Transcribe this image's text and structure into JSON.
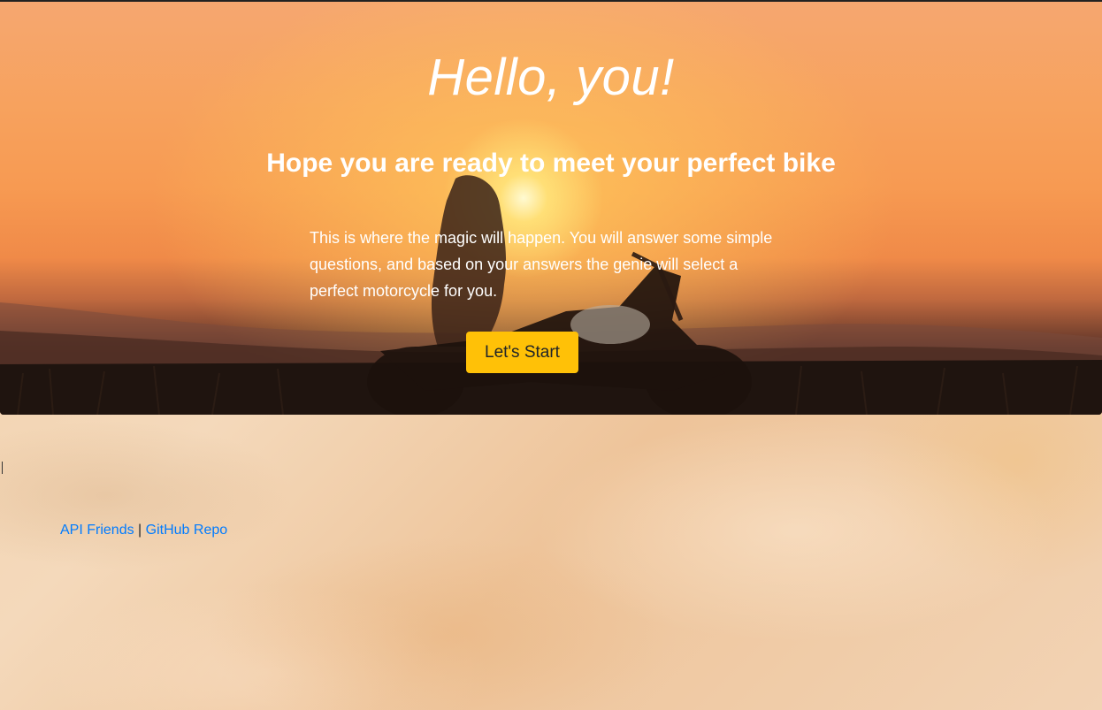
{
  "hero": {
    "title": "Hello, you!",
    "subtitle": "Hope you are ready to meet your perfect bike",
    "text": "This is where the magic will happen. You will answer some simple questions, and based on your answers the genie will select a perfect motorcycle for you.",
    "button_label": "Let's Start",
    "button_color": "#ffc107"
  },
  "footer": {
    "links": [
      {
        "label": "API Friends"
      },
      {
        "label": "GitHub Repo"
      }
    ],
    "separator": "|",
    "link_color": "#007bff"
  }
}
